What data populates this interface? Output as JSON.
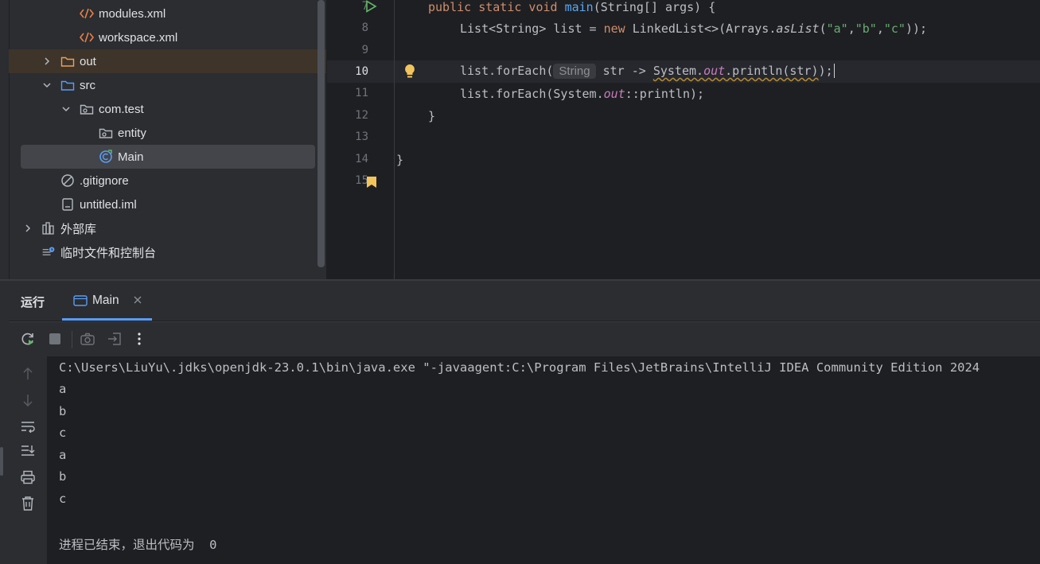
{
  "tree": {
    "items": [
      {
        "label": "modules.xml",
        "icon": "xml-file-icon"
      },
      {
        "label": "workspace.xml",
        "icon": "xml-file-icon"
      },
      {
        "label": "out",
        "icon": "folder-icon"
      },
      {
        "label": "src",
        "icon": "source-folder-icon"
      },
      {
        "label": "com.test",
        "icon": "package-icon"
      },
      {
        "label": "entity",
        "icon": "package-icon"
      },
      {
        "label": "Main",
        "icon": "java-class-icon"
      },
      {
        "label": ".gitignore",
        "icon": "ignore-file-icon"
      },
      {
        "label": "untitled.iml",
        "icon": "iml-file-icon"
      },
      {
        "label": "外部库",
        "icon": "library-icon"
      },
      {
        "label": "临时文件和控制台",
        "icon": "scratches-icon"
      }
    ]
  },
  "editor": {
    "line_numbers": [
      "7",
      "8",
      "9",
      "10",
      "11",
      "12",
      "13",
      "14",
      "15"
    ],
    "lines": {
      "l7_kw": "public static void ",
      "l7_fn": "main",
      "l7_rest": "(String[] args) {",
      "l8_a": "List<String> list = ",
      "l8_new": "new",
      "l8_b": " LinkedList<>(Arrays.",
      "l8_aslist": "asList",
      "l8_c": "(",
      "l8_s1": "\"a\"",
      "l8_comma1": ",",
      "l8_s2": "\"b\"",
      "l8_comma2": ",",
      "l8_s3": "\"c\"",
      "l8_end": "));",
      "l10_a": "list.forEach(",
      "l10_hint": "String",
      "l10_b": " str -> ",
      "l10_sys": "System.",
      "l10_out": "out",
      "l10_println": ".println(str)",
      "l10_end": ");",
      "l11_a": "list.forEach(System.",
      "l11_out": "out",
      "l11_end": "::println);",
      "l12": "}",
      "l14": "}"
    }
  },
  "run": {
    "tab_run_label": "运行",
    "tab_main_label": "Main",
    "console": [
      "C:\\Users\\LiuYu\\.jdks\\openjdk-23.0.1\\bin\\java.exe \"-javaagent:C:\\Program Files\\JetBrains\\IntelliJ IDEA Community Edition 2024",
      "a",
      "b",
      "c",
      "a",
      "b",
      "c",
      "",
      "进程已结束，退出代码为  0"
    ]
  },
  "colors": {
    "background": "#1e1f22",
    "panel": "#2b2d30",
    "keyword": "#cf8e6d",
    "function": "#56a8f5",
    "string": "#6aab73",
    "static_field": "#c77dbb",
    "run_green": "#5fb865",
    "bookmark_yellow": "#f2c55c"
  }
}
